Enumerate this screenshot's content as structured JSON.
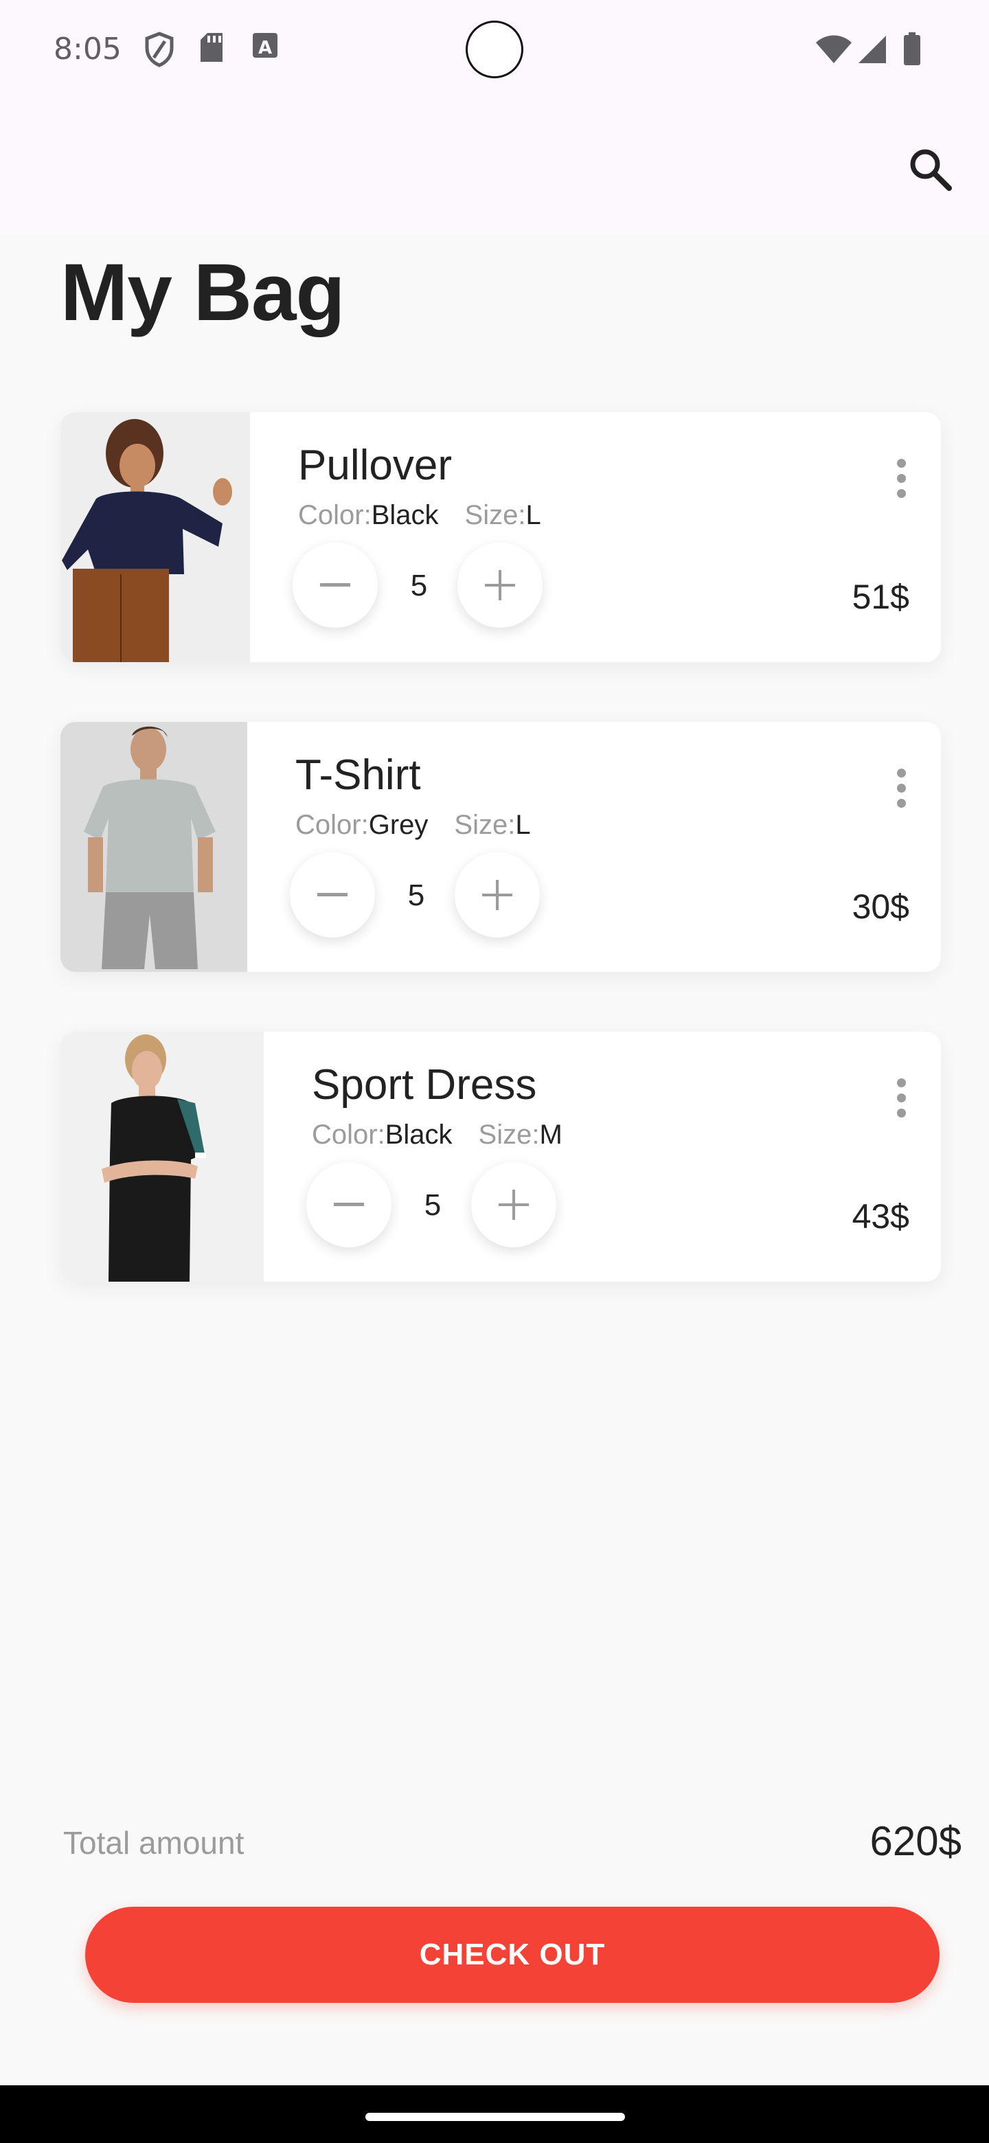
{
  "status_bar": {
    "time": "8:05",
    "icons": [
      "shield-icon",
      "sd-card-icon",
      "font-a-icon",
      "wifi-icon",
      "signal-icon",
      "battery-icon"
    ]
  },
  "app_bar": {
    "actions": [
      "search-icon"
    ]
  },
  "page": {
    "title": "My Bag"
  },
  "labels": {
    "color": "Color:",
    "size": "Size:"
  },
  "items": [
    {
      "name": "Pullover",
      "color": "Black",
      "size": "L",
      "quantity": "5",
      "price": "51$",
      "image": "woman-pullover-photo"
    },
    {
      "name": "T-Shirt",
      "color": "Grey",
      "size": "L",
      "quantity": "5",
      "price": "30$",
      "image": "man-tshirt-photo"
    },
    {
      "name": "Sport Dress",
      "color": "Black",
      "size": "M",
      "quantity": "5",
      "price": "43$",
      "image": "woman-sport-dress-photo"
    }
  ],
  "summary": {
    "total_label": "Total amount",
    "total_value": "620$"
  },
  "checkout": {
    "label": "CHECK OUT"
  },
  "colors": {
    "accent": "#f44336",
    "text": "#222222",
    "muted": "#9b9b9b",
    "background": "#f9f9f9"
  }
}
